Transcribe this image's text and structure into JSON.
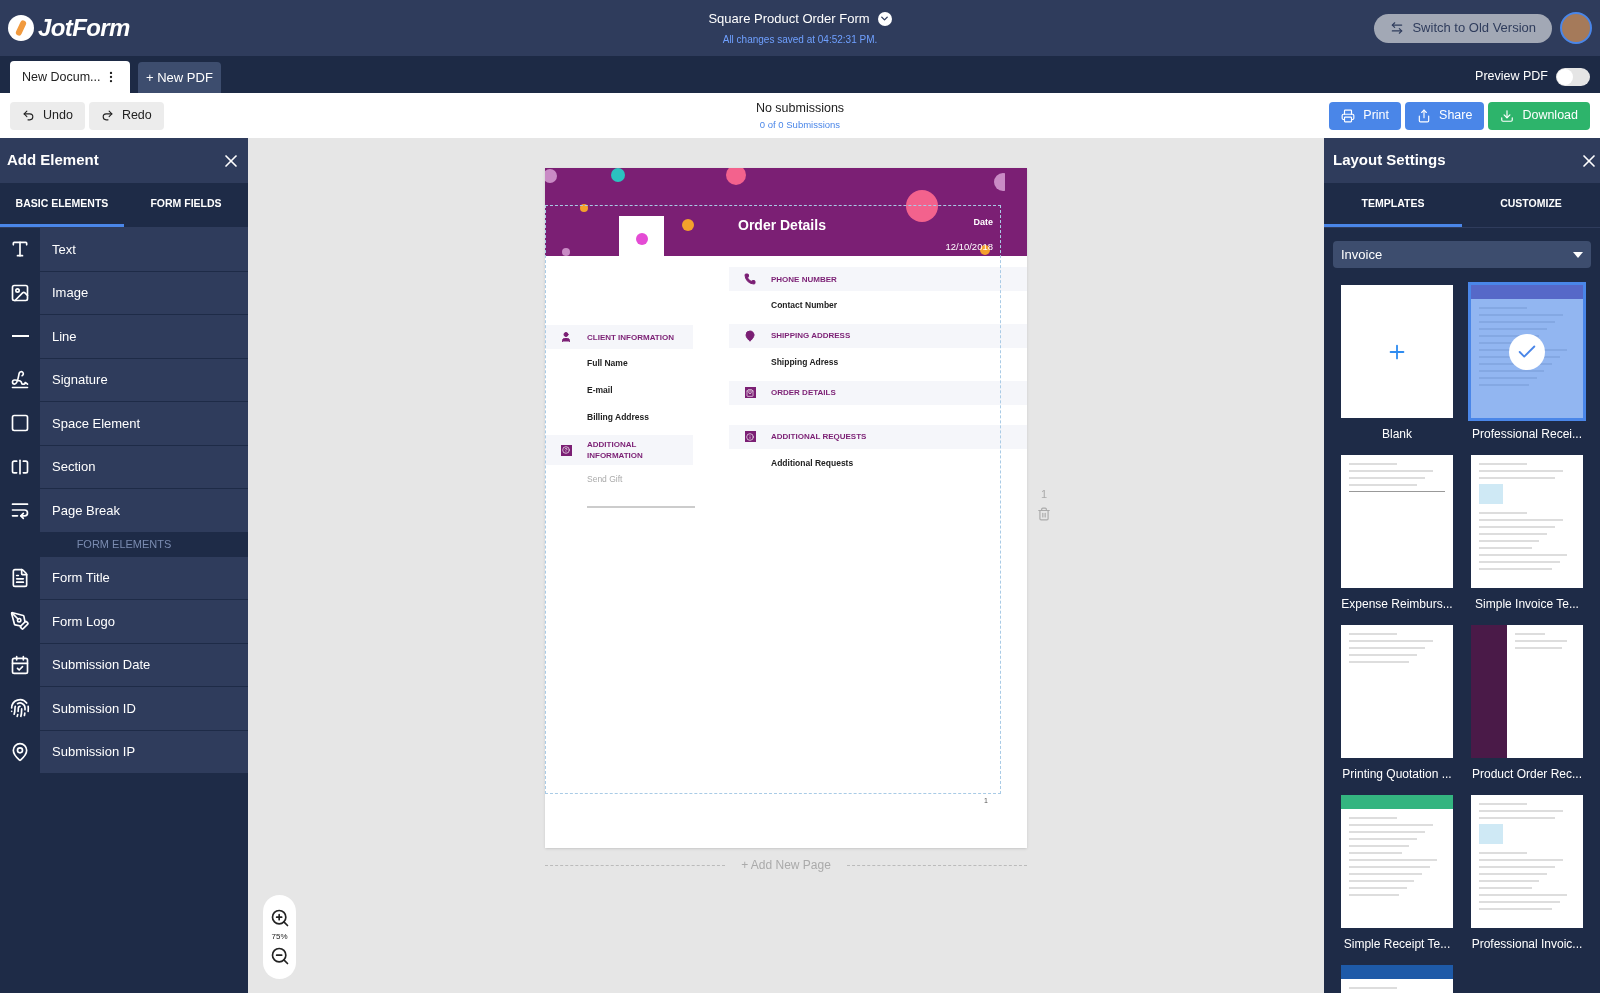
{
  "header": {
    "logo": "JotForm",
    "title": "Square Product Order Form",
    "saved": "All changes saved at 04:52:31 PM.",
    "switch_button": "Switch to Old Version"
  },
  "doc_tabs": [
    {
      "label": "New Docum...",
      "selected": true
    }
  ],
  "new_pdf": "+ New PDF",
  "preview_pdf": {
    "label": "Preview PDF",
    "on": false
  },
  "toolbar": {
    "undo": "Undo",
    "redo": "Redo",
    "status": "No submissions",
    "count": "0 of 0 Submissions",
    "print": "Print",
    "share": "Share",
    "download": "Download"
  },
  "left_panel": {
    "title": "Add Element",
    "tabs": [
      {
        "label": "BASIC ELEMENTS",
        "selected": true
      },
      {
        "label": "FORM FIELDS",
        "selected": false
      }
    ],
    "basic": [
      "Text",
      "Image",
      "Line",
      "Signature",
      "Space Element",
      "Section",
      "Page Break"
    ],
    "group_label": "FORM ELEMENTS",
    "form": [
      "Form Title",
      "Form Logo",
      "Submission Date",
      "Submission ID",
      "Submission IP"
    ]
  },
  "page": {
    "title": "Order Details",
    "date_label": "Date",
    "date": "12/10/2018",
    "page_number": "1",
    "left_sections": [
      {
        "kind": "person",
        "title": "CLIENT INFORMATION",
        "fields": [
          {
            "kind": "label",
            "text": "Full Name"
          },
          {
            "kind": "label",
            "text": "E-mail"
          },
          {
            "kind": "label",
            "text": "Billing Address"
          }
        ]
      },
      {
        "kind": "question",
        "title": "ADDITIONAL INFORMATION",
        "fields": [
          {
            "kind": "input",
            "placeholder": "Send Gift"
          }
        ]
      }
    ],
    "right_sections": [
      {
        "kind": "phone",
        "title": "PHONE NUMBER",
        "fields": [
          {
            "kind": "label",
            "text": "Contact Number"
          }
        ]
      },
      {
        "kind": "pin",
        "title": "SHIPPING ADDRESS",
        "fields": [
          {
            "kind": "label",
            "text": "Shipping Adress"
          }
        ]
      },
      {
        "kind": "bag",
        "title": "ORDER DETAILS"
      },
      {
        "kind": "info",
        "title": "ADDITIONAL REQUESTS",
        "fields": [
          {
            "kind": "label",
            "text": "Additional Requests"
          }
        ]
      }
    ]
  },
  "side_page_number": "1",
  "add_page": "+ Add New Page",
  "zoom": "75%",
  "right_panel": {
    "title": "Layout Settings",
    "tabs": [
      {
        "label": "TEMPLATES",
        "selected": true
      },
      {
        "label": "CUSTOMIZE",
        "selected": false
      }
    ],
    "category": "Invoice",
    "templates": [
      {
        "kind": "blank",
        "label": "Blank",
        "selected": false
      },
      {
        "kind": "header",
        "label": "Professional Recei...",
        "selected": true
      },
      {
        "kind": "table",
        "label": "Expense Reimburs...",
        "selected": false
      },
      {
        "kind": "invoice",
        "label": "Simple Invoice Te...",
        "selected": false
      },
      {
        "kind": "text",
        "label": "Printing Quotation ...",
        "selected": false
      },
      {
        "kind": "sidebar",
        "label": "Product Order Rec...",
        "selected": false
      },
      {
        "kind": "header",
        "label": "Simple Receipt Te...",
        "selected": false
      },
      {
        "kind": "invoice",
        "label": "Professional Invoic...",
        "selected": false
      },
      {
        "kind": "header",
        "selected": false
      }
    ]
  }
}
